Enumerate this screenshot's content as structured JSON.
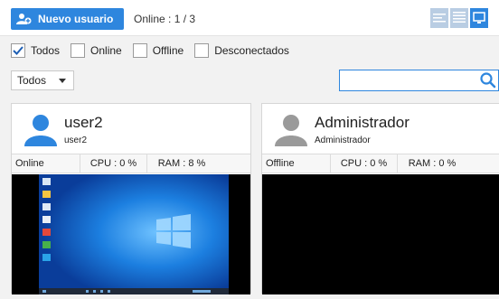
{
  "toolbar": {
    "new_user_label": "Nuevo usuario",
    "online_count": "Online : 1 / 3",
    "view_icons": [
      "list-compact-icon",
      "list-detail-icon",
      "screen-view-icon"
    ],
    "accent_color": "#2e86de"
  },
  "filters": {
    "items": [
      {
        "label": "Todos",
        "checked": true
      },
      {
        "label": "Online",
        "checked": false
      },
      {
        "label": "Offline",
        "checked": false
      },
      {
        "label": "Desconectados",
        "checked": false
      }
    ]
  },
  "group_select": {
    "value": "Todos"
  },
  "search": {
    "value": "",
    "icon": "search-icon"
  },
  "users": [
    {
      "name": "user2",
      "subname": "user2",
      "status": "Online",
      "cpu": "CPU : 0 %",
      "ram": "RAM : 8 %",
      "avatar_color": "#2e86de",
      "screen": "windows-desktop"
    },
    {
      "name": "Administrador",
      "subname": "Administrador",
      "status": "Offline",
      "cpu": "CPU : 0 %",
      "ram": "RAM : 0 %",
      "avatar_color": "#9a9a9a",
      "screen": "blank"
    }
  ]
}
